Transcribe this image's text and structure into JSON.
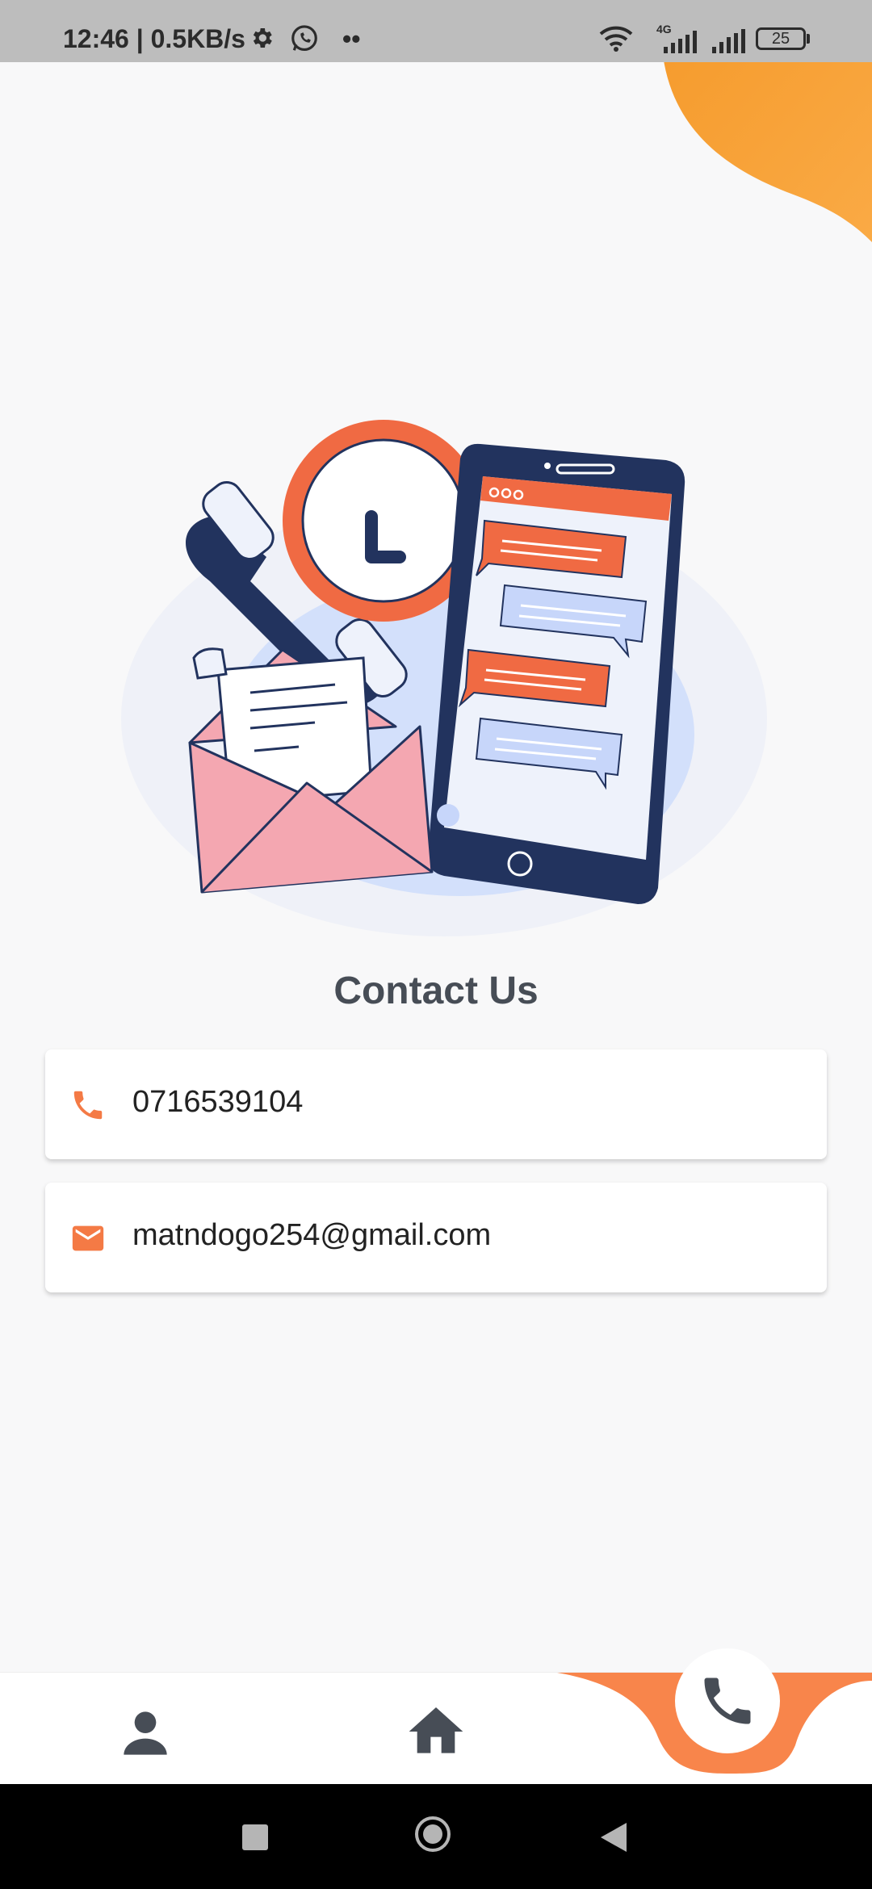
{
  "status_bar": {
    "time_speed": "12:46 | 0.5KB/s",
    "dots": "••",
    "network_type": "4G",
    "battery": "25"
  },
  "page": {
    "title": "Contact Us"
  },
  "contacts": {
    "phone": "0716539104",
    "email": "matndogo254@gmail.com"
  },
  "colors": {
    "accent": "#f47a45",
    "corner_blob": "#f9a23a",
    "navy": "#22335e",
    "nav_icon": "#474d56"
  },
  "bottom_nav": {
    "items": [
      {
        "icon": "person-icon"
      },
      {
        "icon": "home-icon"
      },
      {
        "icon": "phone-icon",
        "active": true
      }
    ]
  }
}
